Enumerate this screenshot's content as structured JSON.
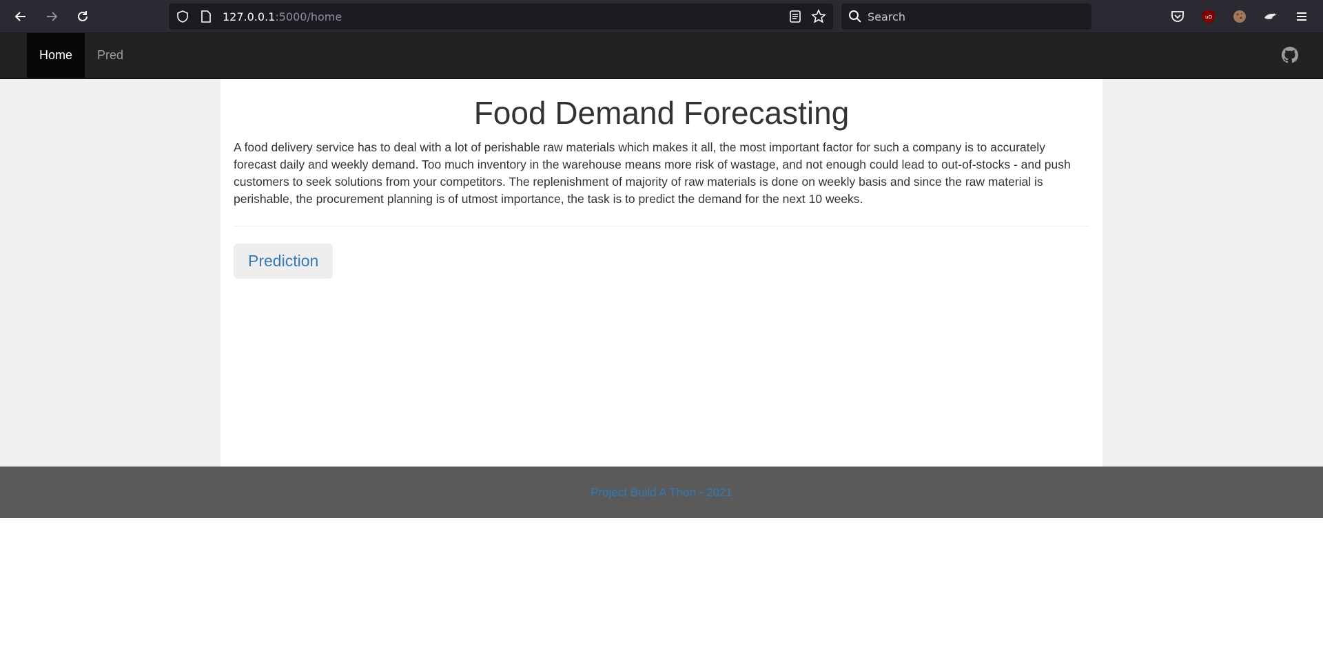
{
  "browser": {
    "url_host": "127.0.0.1",
    "url_path": ":5000/home",
    "search_placeholder": "Search"
  },
  "navbar": {
    "items": [
      {
        "label": "Home",
        "active": true
      },
      {
        "label": "Pred",
        "active": false
      }
    ]
  },
  "main": {
    "title": "Food Demand Forecasting",
    "description": "A food delivery service has to deal with a lot of perishable raw materials which makes it all, the most important factor for such a company is to accurately forecast daily and weekly demand. Too much inventory in the warehouse means more risk of wastage, and not enough could lead to out-of-stocks - and push customers to seek solutions from your competitors. The replenishment of majority of raw materials is done on weekly basis and since the raw material is perishable, the procurement planning is of utmost importance, the task is to predict the demand for the next 10 weeks.",
    "button_label": "Prediction"
  },
  "footer": {
    "text": "Project Build A Thon - 2021"
  },
  "colors": {
    "navbar_bg": "#222222",
    "link": "#337ab7",
    "footer_bg": "#5a5a5a"
  }
}
